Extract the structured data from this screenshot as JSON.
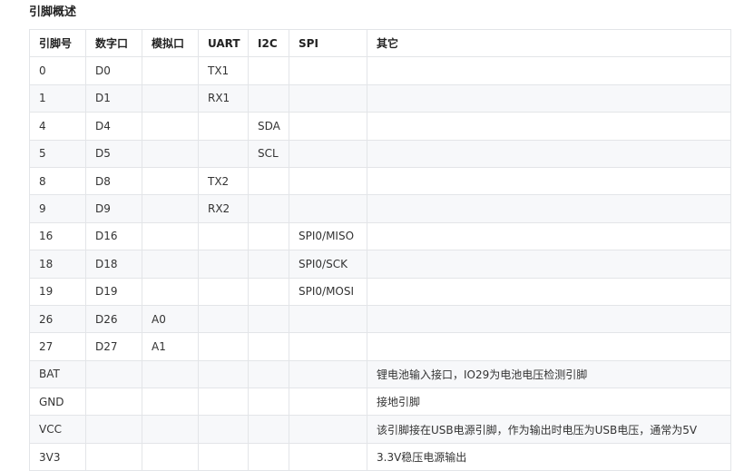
{
  "title": "引脚概述",
  "headers": [
    "引脚号",
    "数字口",
    "模拟口",
    "UART",
    "I2C",
    "SPI",
    "其它"
  ],
  "rows": [
    [
      "0",
      "D0",
      "",
      "TX1",
      "",
      "",
      ""
    ],
    [
      "1",
      "D1",
      "",
      "RX1",
      "",
      "",
      ""
    ],
    [
      "4",
      "D4",
      "",
      "",
      "SDA",
      "",
      ""
    ],
    [
      "5",
      "D5",
      "",
      "",
      "SCL",
      "",
      ""
    ],
    [
      "8",
      "D8",
      "",
      "TX2",
      "",
      "",
      ""
    ],
    [
      "9",
      "D9",
      "",
      "RX2",
      "",
      "",
      ""
    ],
    [
      "16",
      "D16",
      "",
      "",
      "",
      "SPI0/MISO",
      ""
    ],
    [
      "18",
      "D18",
      "",
      "",
      "",
      "SPI0/SCK",
      ""
    ],
    [
      "19",
      "D19",
      "",
      "",
      "",
      "SPI0/MOSI",
      ""
    ],
    [
      "26",
      "D26",
      "A0",
      "",
      "",
      "",
      ""
    ],
    [
      "27",
      "D27",
      "A1",
      "",
      "",
      "",
      ""
    ],
    [
      "BAT",
      "",
      "",
      "",
      "",
      "",
      "锂电池输入接口，IO29为电池电压检测引脚"
    ],
    [
      "GND",
      "",
      "",
      "",
      "",
      "",
      "接地引脚"
    ],
    [
      "VCC",
      "",
      "",
      "",
      "",
      "",
      "该引脚接在USB电源引脚，作为输出时电压为USB电压，通常为5V"
    ],
    [
      "3V3",
      "",
      "",
      "",
      "",
      "",
      "3.3V稳压电源输出"
    ]
  ]
}
